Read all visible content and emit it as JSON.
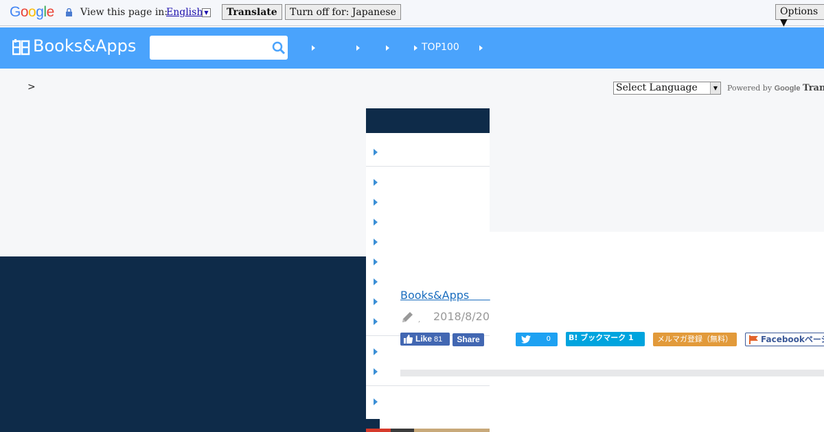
{
  "translate_bar": {
    "logo": "Google",
    "view_label": "View this page in:",
    "language": "English",
    "translate_button": "Translate",
    "turn_off_button": "Turn off for: Japanese",
    "options_button": "Options ▼"
  },
  "header": {
    "brand": "Books&Apps",
    "search_placeholder": "",
    "nav_item_top100": "TOP100"
  },
  "breadcrumb": ">",
  "language_select": {
    "selected": "Select Language",
    "powered_by": "Powered by",
    "google": "Google",
    "translate": "Translate"
  },
  "article": {
    "author_link": "Books&Apps",
    "date": "2018/8/20"
  },
  "share": {
    "like_label": "Like",
    "like_count": "81",
    "share_label": "Share",
    "tweet_count": "0",
    "hatena_label": "B! ブックマーク 1",
    "mailmag_label": "メルマガ登録（無料）",
    "facebook_page_label": "Facebookページ"
  },
  "colors": {
    "header_blue": "#4aa3fc",
    "navy": "#0e2b49",
    "twitter": "#1da1f2",
    "hatena": "#00a4de",
    "facebook": "#4267b2",
    "mailmag": "#e29a3a"
  }
}
